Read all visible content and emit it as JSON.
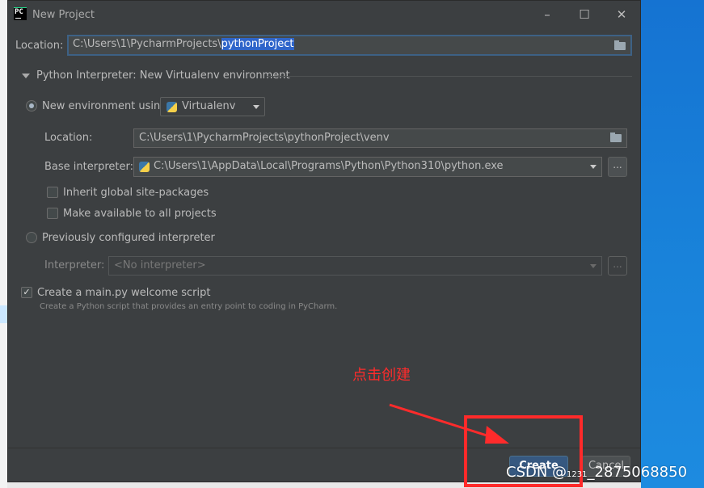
{
  "window": {
    "app_icon": "PC",
    "title": "New Project",
    "controls": [
      "minimize-icon",
      "maximize-icon",
      "close-icon"
    ]
  },
  "location": {
    "label": "Location:",
    "value_prefix": "C:\\Users\\1\\PycharmProjects\\",
    "value_selected": "pythonProject"
  },
  "interpreter_section": {
    "title": "Python Interpreter: New Virtualenv environment",
    "new_env": {
      "label": "New environment using",
      "tool": "Virtualenv",
      "selected": true,
      "location_label": "Location:",
      "location_value": "C:\\Users\\1\\PycharmProjects\\pythonProject\\venv",
      "base_label": "Base interpreter:",
      "base_value": "C:\\Users\\1\\AppData\\Local\\Programs\\Python\\Python310\\python.exe",
      "browse_label": "...",
      "inherit_label": "Inherit global site-packages",
      "inherit_checked": false,
      "available_label": "Make available to all projects",
      "available_checked": false
    },
    "previous": {
      "label": "Previously configured interpreter",
      "selected": false,
      "interpreter_label": "Interpreter:",
      "interpreter_value": "<No interpreter>",
      "browse_label": "..."
    }
  },
  "welcome": {
    "label": "Create a main.py welcome script",
    "checked": true,
    "hint": "Create a Python script that provides an entry point to coding in PyCharm."
  },
  "buttons": {
    "create": "Create",
    "cancel": "Cancel"
  },
  "annotation": {
    "text": "点击创建",
    "color": "#ff2b2b"
  },
  "watermark": {
    "brand": "CSDN @",
    "small": "1231",
    "rest": "_2875068850"
  },
  "colors": {
    "dialog_bg": "#3c3f41",
    "selection": "#2f65ca",
    "primary_button": "#365880",
    "desktop": "#1778d1"
  }
}
